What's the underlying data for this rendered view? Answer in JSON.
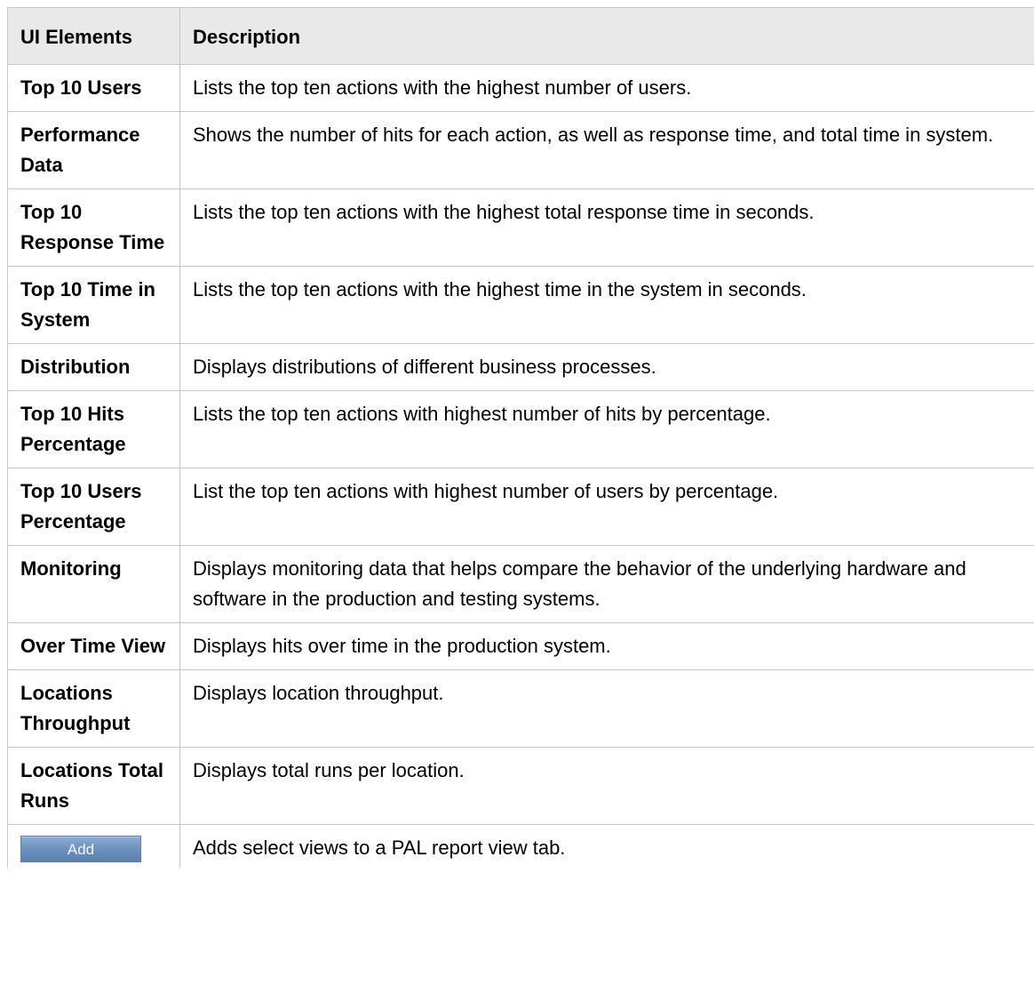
{
  "table": {
    "headers": [
      "UI Elements",
      "Description"
    ],
    "rows": [
      {
        "element": "Top 10 Users",
        "description": "Lists the top ten actions with the highest number of users."
      },
      {
        "element": "Performance Data",
        "description": "Shows the number of hits for each action, as well as response time, and total time in system."
      },
      {
        "element": "Top 10 Response Time",
        "description": "Lists the top ten actions with the highest total response time in seconds."
      },
      {
        "element": "Top 10 Time in System",
        "description": "Lists the top ten actions with the highest time in the system in seconds."
      },
      {
        "element": "Distribution",
        "description": "Displays distributions of different business processes."
      },
      {
        "element": "Top 10 Hits Percentage",
        "description": "Lists the top ten actions with highest number of hits by percentage."
      },
      {
        "element": "Top 10 Users Percentage",
        "description": "List the top ten actions with highest number of users by percentage."
      },
      {
        "element": "Monitoring",
        "description": "Displays monitoring data that helps compare the behavior of the underlying hardware and software in the production and testing systems."
      },
      {
        "element": "Over Time View",
        "description": "Displays hits over time in the production system."
      },
      {
        "element": "Locations Throughput",
        "description": "Displays location throughput."
      },
      {
        "element": "Locations Total Runs",
        "description": "Displays total runs per location."
      }
    ],
    "add_row": {
      "button_label": "Add",
      "description": "Adds select views to a PAL report view tab."
    }
  }
}
